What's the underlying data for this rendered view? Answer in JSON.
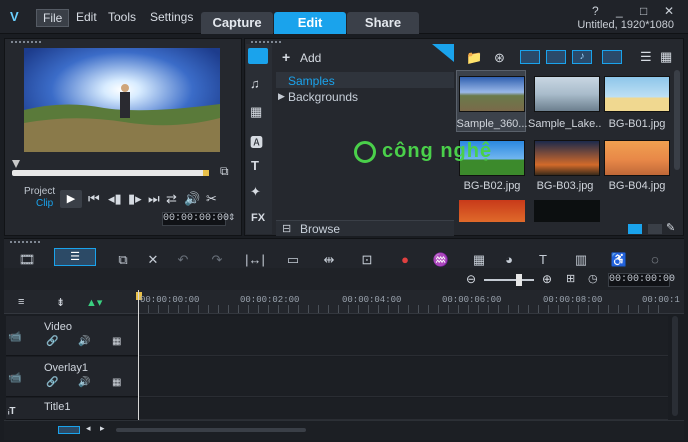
{
  "app": {
    "title_info": "Untitled, 1920*1080"
  },
  "menu": [
    "File",
    "Edit",
    "Tools",
    "Settings"
  ],
  "tabs": [
    "Capture",
    "Edit",
    "Share"
  ],
  "window_controls": [
    "?",
    "_",
    "□",
    "✕"
  ],
  "player": {
    "mode_project": "Project",
    "mode_clip": "Clip",
    "timecode": "00:00:00:00"
  },
  "library": {
    "add_label": "Add",
    "tree": [
      "Samples",
      "Backgrounds"
    ],
    "browse_label": "Browse",
    "fx_label": "FX",
    "thumbs": [
      {
        "label": "Sample_360...",
        "selected": true
      },
      {
        "label": "Sample_Lake..."
      },
      {
        "label": "BG-B01.jpg"
      },
      {
        "label": "BG-B02.jpg"
      },
      {
        "label": "BG-B03.jpg"
      },
      {
        "label": "BG-B04.jpg"
      }
    ]
  },
  "timeline": {
    "zoom_timecode": "00:00:00:00",
    "ruler": [
      "00:00:00:00",
      "00:00:02:00",
      "00:00:04:00",
      "00:00:06:00",
      "00:00:08:00",
      "00:00:1"
    ],
    "tracks": [
      "Video",
      "Overlay1",
      "Title1"
    ]
  },
  "watermark": "công nghệ",
  "colors": {
    "accent": "#1aa3ec",
    "background": "#1a1d22",
    "panel": "#25282e"
  }
}
